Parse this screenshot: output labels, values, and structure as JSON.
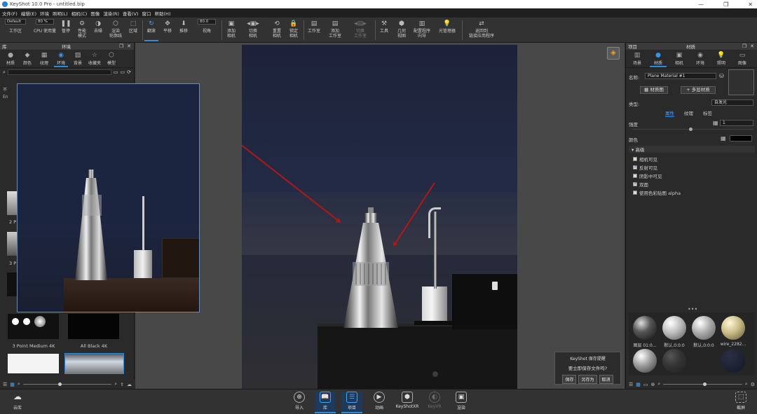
{
  "window": {
    "title": "KeyShot 10.0 Pro - untitled.bip",
    "controls": [
      "—",
      "❐",
      "✕"
    ]
  },
  "menu": [
    "文件(F)",
    "编辑(E)",
    "环境",
    "照明(L)",
    "相机(C)",
    "图像",
    "渲染(R)",
    "查看(V)",
    "窗口",
    "帮助(H)"
  ],
  "toolbar": {
    "workspace_value": "Default",
    "workspace_label": "工作区",
    "cpu_value": "80 %",
    "cpu_label": "CPU 使用量",
    "pause_label": "暂停",
    "perf_label": "性能\n模式",
    "denoise_label": "去噪",
    "render_label": "渲染\n轮廓线",
    "region_label": "区域",
    "tumble_label": "翻滚",
    "pan_label": "平移",
    "dolly_label": "推移",
    "fov_value": "80.0",
    "fov_label": "视角",
    "add_camera_label": "添加\n相机",
    "switch_camera_label": "切换\n相机",
    "reset_camera_label": "重置\n相机",
    "lock_camera_label": "锁定\n相机",
    "studio_label": "工作室",
    "add_studio_label": "添加\n工作室",
    "switch_studio_label": "切换\n工作室",
    "tools_label": "工具",
    "geometry_label": "几何\n视图",
    "config_label": "配置程序\n向导",
    "light_manager_label": "光管理器",
    "send_back_label": "返回到\n链接应用程序"
  },
  "library": {
    "header_title": "库",
    "env_header_title": "环境",
    "tabs": [
      {
        "label": "材质",
        "icon": "material-icon"
      },
      {
        "label": "颜色",
        "icon": "color-icon"
      },
      {
        "label": "纹理",
        "icon": "texture-icon"
      },
      {
        "label": "环境",
        "icon": "environment-icon"
      },
      {
        "label": "背景",
        "icon": "background-icon"
      },
      {
        "label": "收藏夹",
        "icon": "favorites-icon"
      },
      {
        "label": "模型",
        "icon": "model-icon"
      }
    ],
    "tree_items": [
      "不",
      "En"
    ],
    "side_labels": [
      "2 P",
      "3 P"
    ],
    "thumbnails": [
      {
        "label": "3 Point Medium 4K"
      },
      {
        "label": "All Black 4K"
      }
    ]
  },
  "right_panel": {
    "project_title": "项目",
    "material_title": "材质",
    "tabs": [
      {
        "label": "场景",
        "icon": "scene-icon"
      },
      {
        "label": "材质",
        "icon": "material-icon"
      },
      {
        "label": "相机",
        "icon": "camera-icon"
      },
      {
        "label": "环境",
        "icon": "environment-icon"
      },
      {
        "label": "照明",
        "icon": "lighting-icon"
      },
      {
        "label": "图像",
        "icon": "image-icon"
      }
    ],
    "name_label": "名称:",
    "name_value": "Plane Material #1",
    "material_graph_button": "材质图",
    "multi_layer_button": "多层材质",
    "type_label": "类型:",
    "type_value": "自发光",
    "subtabs": [
      "属性",
      "纹理",
      "标签"
    ],
    "intensity_label": "强度",
    "intensity_value": "1",
    "color_label": "颜色",
    "color_value": "#000000",
    "advanced_label": "高级",
    "checkboxes": [
      {
        "label": "相机可见",
        "checked": false
      },
      {
        "label": "反射可见",
        "checked": true
      },
      {
        "label": "阴影中可见",
        "checked": false
      },
      {
        "label": "双面",
        "checked": true
      },
      {
        "label": "使用色彩贴图 alpha",
        "checked": false
      }
    ],
    "material_balls": [
      {
        "label": "图层 01:0..."
      },
      {
        "label": "默认,0:0:0"
      },
      {
        "label": "默认,0:0:0"
      },
      {
        "label": "wire_2282..."
      },
      {
        "label": ""
      },
      {
        "label": ""
      },
      {
        "label": ""
      }
    ]
  },
  "save_dialog": {
    "title": "KeyShot 保存提醒",
    "message": "要立即保存文件吗?",
    "save": "保存",
    "save_as": "另存为",
    "cancel": "取消"
  },
  "bottombar": {
    "cloud_library": "云库",
    "import": "导入",
    "library": "库",
    "project": "项目",
    "animation": "动画",
    "keyshotxr": "KeyShotXR",
    "keyvr": "KeyVR",
    "render": "渲染",
    "screenshot": "截屏"
  },
  "colors": {
    "accent": "#2f8ad8",
    "render_wall": "#222a45",
    "arrow": "#b01818"
  }
}
